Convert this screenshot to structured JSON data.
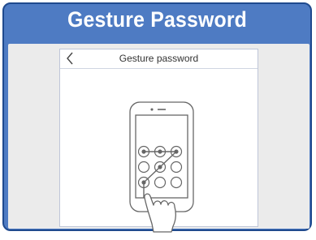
{
  "banner": {
    "title": "Gesture Password"
  },
  "screen": {
    "nav_title": "Gesture password",
    "back_icon": "chevron-left-icon"
  },
  "illustration": {
    "icon": "pattern-lock-phone-icon",
    "description_icons": [
      "phone-icon",
      "pattern-grid-icon",
      "hand-pointer-icon"
    ]
  },
  "colors": {
    "banner": "#4e7bc3",
    "banner_border": "#1f4a8e",
    "content_bg": "#ebebeb",
    "line": "#666666"
  }
}
